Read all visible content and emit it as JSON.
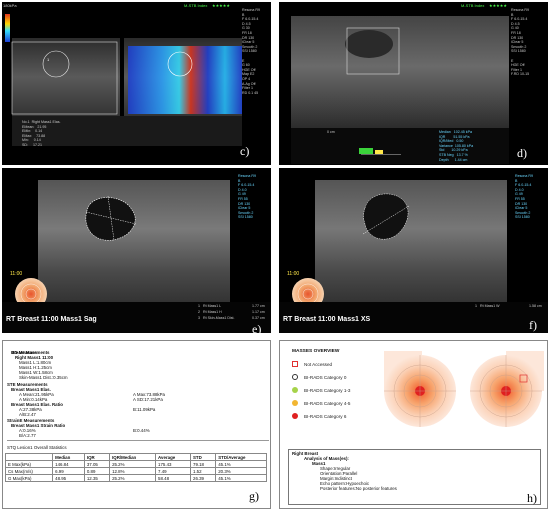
{
  "panels": {
    "c": {
      "label": "c)",
      "header": "M-STB Index",
      "stars": "★★★★★",
      "scale_top": "180kPa",
      "params": "Resona R9\nB\nF 6.0-15.4\nD 4.5\nG 30\nFR 18\nDR 130\niClear 5\nSmooth 2\nSSI 1580\n\nE\nG 60\nHGE Off\nMap E2\nOP 4\nA.Ag Off\nFilter 1\nRD 0.1 45",
      "measure": "No.1  Right Mass1 Elas.\nEMean:   21.95\nEMin:    0.14\nEMax:    73.88\nMin:     0.14\nSD:     17.21",
      "mark": "1"
    },
    "d": {
      "label": "d)",
      "header": "M-STB Index",
      "stars": "★★★★★",
      "params": "Resona R9\nB\nF 6.0-15.4\nD 4.5\nG 40\nFR 18\nDR 130\niClear 5\nSmooth 2\nSSI 1580\n\nE\nHGE Off\nFilter 1\nF.RD 10-15",
      "depth": "0 cm",
      "median": "Median   102.45 kPa\nIQR        51.55 kPa\nIQR/Med   0.50\nVariance  105.80 kPa\nStd       10.29 kPa\nSTB Neg   13.7 %\nDepth      1.44 cm"
    },
    "e": {
      "label": "e)",
      "params": "Resona R9\nB\nF 6.0-15.4\nD 4.0\nG 49\nFR 55\nDR 130\niClear 5\nSmooth 2\nSSI 1580",
      "time": "11:00",
      "title": "RT Breast 11:00 Mass1 Sag",
      "meas1": "1   Rt Mass1 L",
      "val1": "1.77 cm",
      "meas2": "2   Rt Mass1 H",
      "val2": "1.17 cm",
      "meas3": "3   Rt Skin-Mass1 Dist.",
      "val3": "0.37 cm"
    },
    "f": {
      "label": "f)",
      "params": "Resona R9\nB\nF 6.0-15.4\nD 4.0\nG 49\nFR 55\nDR 130\niClear 5\nSmooth 2\nSSI 1580",
      "time": "11:00",
      "title": "RT Breast 11:00 Mass1 XS",
      "meas1": "1   Rt Mass1 W",
      "val1": "1.58 cm"
    },
    "g": {
      "label": "g)",
      "s1": "2D Measurements",
      "s1a": "Breast Mass",
      "s1b": "Right Mass1 11:00",
      "m1": "Mass1 L:1.80cm",
      "m2": "Mass1 H:1.25cm",
      "m3": "Mass1 W:1.58cm",
      "m4": "Skin-Mass1 Dist.:0.35cm",
      "s2": "STE Measurements",
      "s2a": "Breast Mass1 Elas.",
      "e1": "A Mean:21.95kPa",
      "e2": "A Max:73.88kPa",
      "e3": "A Min:0.14kPa",
      "e4": "A SD:17.21kPa",
      "s2b": "Breast Mass1 Elas. Ratio",
      "r1": "A:27.38kPa",
      "r2": "B:11.09kPa",
      "r3": "A/B:2.47",
      "s3": "StrainE Measurements",
      "s3a": "Breast Mass1 Strain Ratio",
      "r4": "A:0.16%",
      "r5": "B:0.44%",
      "r6": "B/A:2.77",
      "stats_title": "STQ Lesion1 Overall Statistics",
      "table": [
        [
          "",
          "Median",
          "IQR",
          "IQR/Median",
          "Average",
          "STD",
          "STD/Average"
        ],
        [
          "E Max(kPa)",
          "146.84",
          "37.05",
          "25.2%",
          "175.43",
          "79.18",
          "45.1%"
        ],
        [
          "Cs Max(m/s)",
          "6.99",
          "0.89",
          "12.8%",
          "7.49",
          "1.52",
          "20.3%"
        ],
        [
          "G Max(kPa)",
          "48.95",
          "12.35",
          "25.2%",
          "58.48",
          "26.39",
          "45.1%"
        ]
      ]
    },
    "h": {
      "label": "h)",
      "overview": "MASSES OVERVIEW",
      "legend": [
        {
          "label": "Not Accessed",
          "color": "#e03030"
        },
        {
          "label": "BI-RADS Category 0",
          "color": "#ffffff"
        },
        {
          "label": "BI-RADS Category 1-3",
          "color": "#a6d34a"
        },
        {
          "label": "BI-RADS Category 4-5",
          "color": "#f2b632"
        },
        {
          "label": "BI-RADS Category 6",
          "color": "#e02020"
        }
      ],
      "right_breast": "Right Breast",
      "analysis": "Analysis of Mass(es):",
      "mass": "Mass1",
      "f1": "Shape:Irregular",
      "f2": "Orientation:Parallel",
      "f3": "Margin:Indistinct",
      "f4": "Echo pattern:Hypoechoic",
      "f5": "Posterior features:No posterior features"
    }
  },
  "colors": {
    "ultrasound_bg": "#000000",
    "elasto_red": "#e0341c",
    "elasto_blue": "#1d3fd6",
    "roi_yellow": "#ffe84a",
    "target_center": "#e8552d",
    "target_ring": "#f2a36a"
  }
}
